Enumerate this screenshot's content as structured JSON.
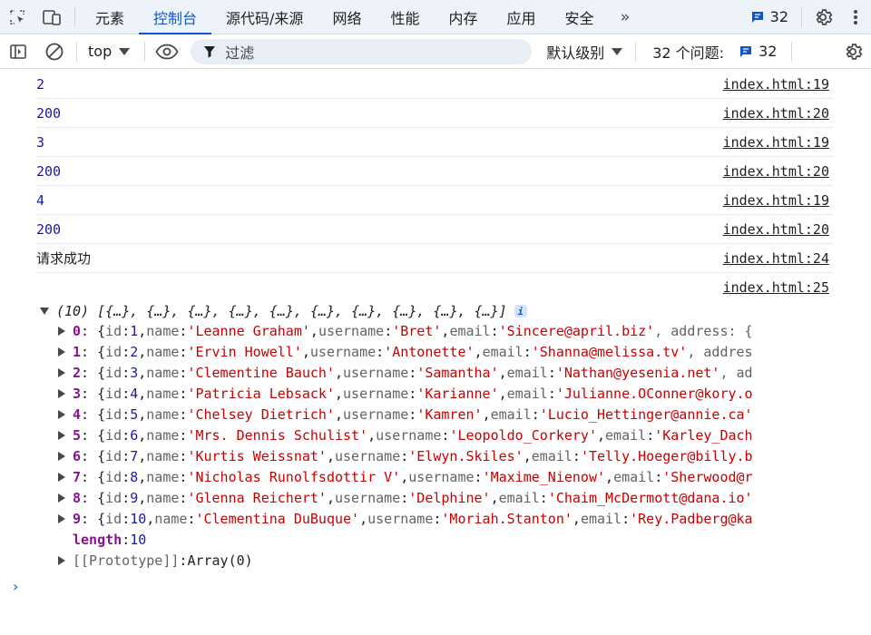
{
  "tabs": [
    {
      "label": "元素",
      "active": false
    },
    {
      "label": "控制台",
      "active": true
    },
    {
      "label": "源代码/来源",
      "active": false
    },
    {
      "label": "网络",
      "active": false
    },
    {
      "label": "性能",
      "active": false
    },
    {
      "label": "内存",
      "active": false
    },
    {
      "label": "应用",
      "active": false
    },
    {
      "label": "安全",
      "active": false
    }
  ],
  "header": {
    "issues_badge": "32"
  },
  "toolbar": {
    "context": "top",
    "filter_placeholder": "过滤",
    "level": "默认级别",
    "issues_label": "32 个问题:",
    "issues_count": "32"
  },
  "messages": [
    {
      "text": "2",
      "kind": "num",
      "source": "index.html:19"
    },
    {
      "text": "200",
      "kind": "num",
      "source": "index.html:20"
    },
    {
      "text": "3",
      "kind": "num",
      "source": "index.html:19"
    },
    {
      "text": "200",
      "kind": "num",
      "source": "index.html:20"
    },
    {
      "text": "4",
      "kind": "num",
      "source": "index.html:19"
    },
    {
      "text": "200",
      "kind": "num",
      "source": "index.html:20"
    },
    {
      "text": "请求成功",
      "kind": "text",
      "source": "index.html:24"
    },
    {
      "text": "",
      "kind": "text",
      "source": "index.html:25"
    }
  ],
  "array": {
    "summary": "(10) [{…}, {…}, {…}, {…}, {…}, {…}, {…}, {…}, {…}, {…}]",
    "items": [
      {
        "index": "0",
        "id": "1",
        "name": "'Leanne Graham'",
        "username": "'Bret'",
        "email": "'Sincere@april.biz'",
        "tail": ", address: {"
      },
      {
        "index": "1",
        "id": "2",
        "name": "'Ervin Howell'",
        "username": "'Antonette'",
        "email": "'Shanna@melissa.tv'",
        "tail": ", addres"
      },
      {
        "index": "2",
        "id": "3",
        "name": "'Clementine Bauch'",
        "username": "'Samantha'",
        "email": "'Nathan@yesenia.net'",
        "tail": ", ad"
      },
      {
        "index": "3",
        "id": "4",
        "name": "'Patricia Lebsack'",
        "username": "'Karianne'",
        "email": "'Julianne.OConner@kory.o",
        "tail": ""
      },
      {
        "index": "4",
        "id": "5",
        "name": "'Chelsey Dietrich'",
        "username": "'Kamren'",
        "email": "'Lucio_Hettinger@annie.ca'",
        "tail": ""
      },
      {
        "index": "5",
        "id": "6",
        "name": "'Mrs. Dennis Schulist'",
        "username": "'Leopoldo_Corkery'",
        "email": "'Karley_Dach",
        "tail": ""
      },
      {
        "index": "6",
        "id": "7",
        "name": "'Kurtis Weissnat'",
        "username": "'Elwyn.Skiles'",
        "email": "'Telly.Hoeger@billy.b",
        "tail": ""
      },
      {
        "index": "7",
        "id": "8",
        "name": "'Nicholas Runolfsdottir V'",
        "username": "'Maxime_Nienow'",
        "email": "'Sherwood@r",
        "tail": ""
      },
      {
        "index": "8",
        "id": "9",
        "name": "'Glenna Reichert'",
        "username": "'Delphine'",
        "email": "'Chaim_McDermott@dana.io'",
        "tail": ""
      },
      {
        "index": "9",
        "id": "10",
        "name": "'Clementina DuBuque'",
        "username": "'Moriah.Stanton'",
        "email": "'Rey.Padberg@ka",
        "tail": ""
      }
    ],
    "keys": {
      "id": "id",
      "name": "name",
      "username": "username",
      "email": "email"
    },
    "length_key": "length",
    "length_value": "10",
    "prototype_key": "[[Prototype]]",
    "prototype_value": "Array(0)"
  },
  "prompt_symbol": "›"
}
